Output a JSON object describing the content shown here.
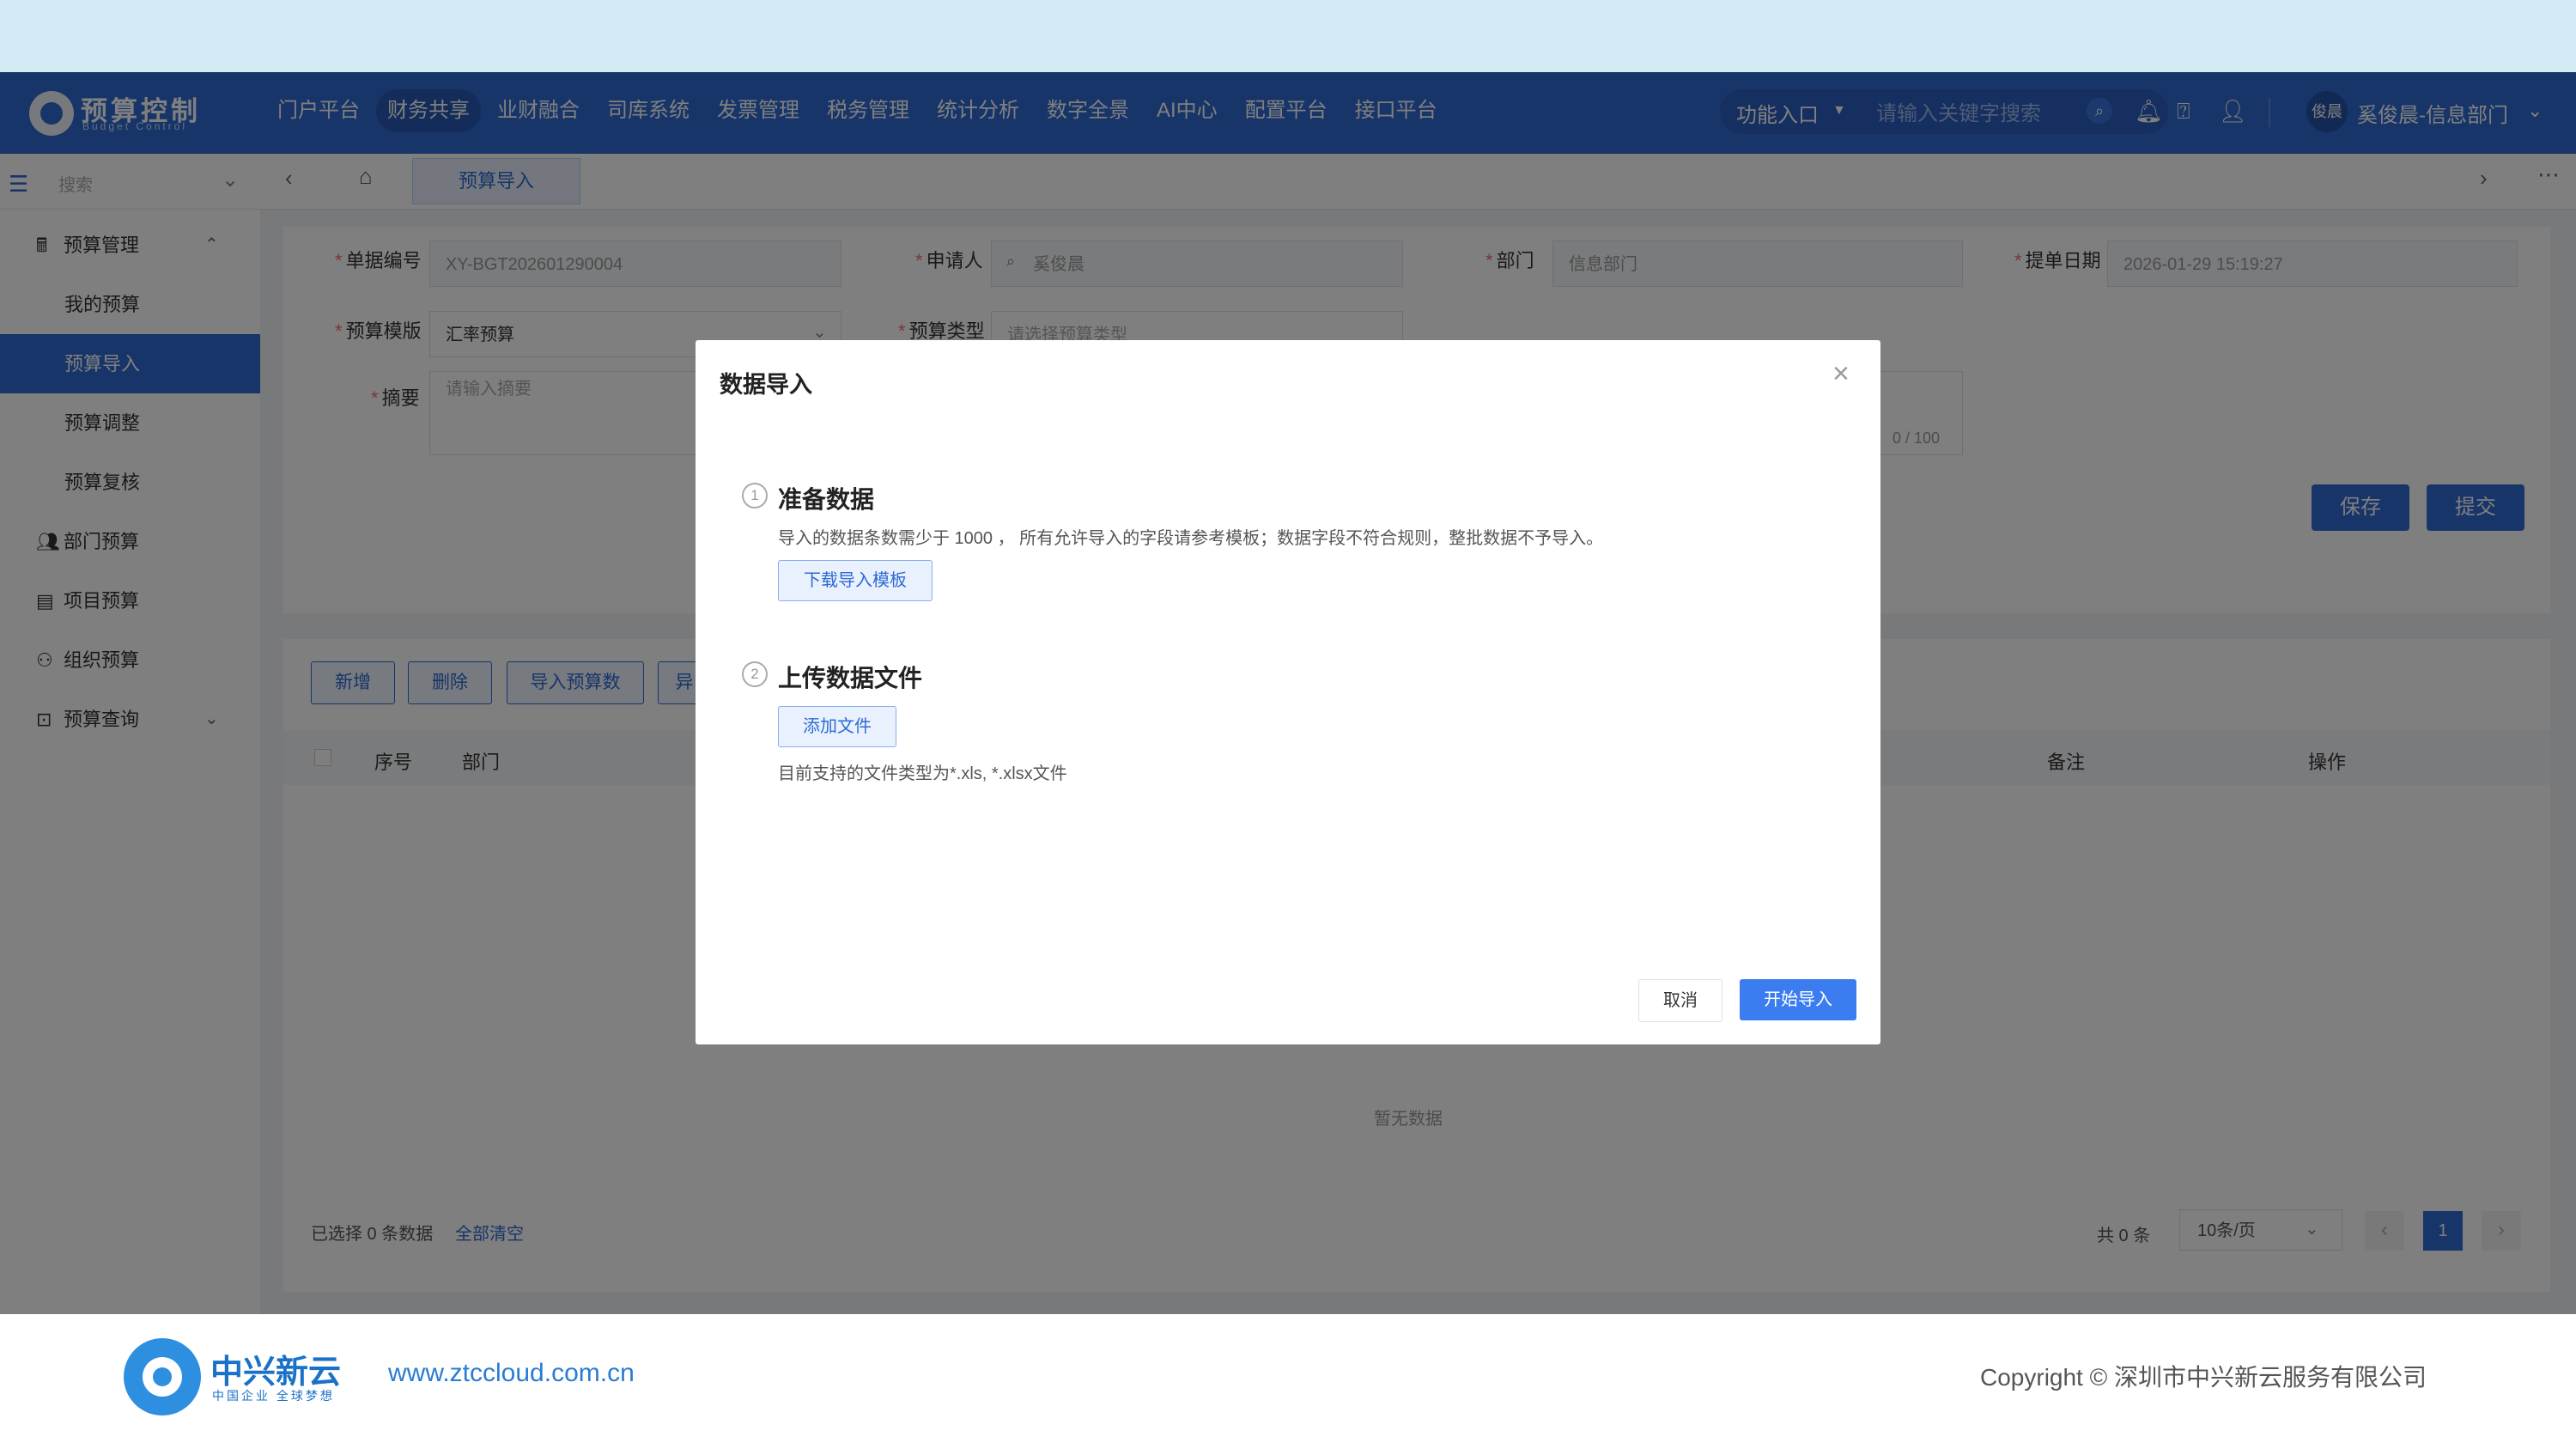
{
  "header": {
    "logo_title": "预算控制",
    "logo_subtitle": "Budget Control",
    "nav": [
      "门户平台",
      "财务共享",
      "业财融合",
      "司库系统",
      "发票管理",
      "税务管理",
      "统计分析",
      "数字全景",
      "AI中心",
      "配置平台",
      "接口平台"
    ],
    "nav_active_index": 1,
    "func_entry": "功能入口",
    "search_placeholder": "请输入关键字搜索",
    "avatar_text": "俊晨",
    "user": "奚俊晨-信息部门"
  },
  "sidebar": {
    "search_placeholder": "搜索",
    "groups": [
      {
        "label": "预算管理",
        "icon": "calculator-icon",
        "expanded": true
      },
      {
        "label": "我的预算"
      },
      {
        "label": "预算导入",
        "active": true
      },
      {
        "label": "预算调整"
      },
      {
        "label": "预算复核"
      },
      {
        "label": "部门预算",
        "icon": "people-icon"
      },
      {
        "label": "项目预算",
        "icon": "document-icon"
      },
      {
        "label": "组织预算",
        "icon": "org-tree-icon"
      },
      {
        "label": "预算查询",
        "icon": "search-doc-icon",
        "expanded": false
      }
    ]
  },
  "tabs": {
    "active_tab": "预算导入"
  },
  "form": {
    "doc_no_label": "单据编号",
    "doc_no": "XY-BGT202601290004",
    "applicant_label": "申请人",
    "applicant": "奚俊晨",
    "dept_label": "部门",
    "dept": "信息部门",
    "date_label": "提单日期",
    "date": "2026-01-29 15:19:27",
    "template_label": "预算模版",
    "template": "汇率预算",
    "type_label": "预算类型",
    "type_placeholder": "请选择预算类型",
    "summary_label": "摘要",
    "summary_placeholder": "请输入摘要",
    "summary_counter": "0 / 100",
    "save": "保存",
    "submit": "提交"
  },
  "table": {
    "buttons": [
      "新增",
      "删除",
      "导入预算数",
      "异"
    ],
    "columns": {
      "index": "序号",
      "dept": "部门",
      "remark": "备注",
      "action": "操作"
    },
    "empty_text": "暂无数据",
    "selected_text": "已选择 0 条数据",
    "clear_all": "全部清空",
    "total": "共 0 条",
    "page_size": "10条/页",
    "current_page": "1"
  },
  "modal": {
    "title": "数据导入",
    "step1_num": "1",
    "step1_title": "准备数据",
    "step1_desc": "导入的数据条数需少于 1000 ， 所有允许导入的字段请参考模板；数据字段不符合规则，整批数据不予导入。",
    "download_template": "下载导入模板",
    "step2_num": "2",
    "step2_title": "上传数据文件",
    "add_file": "添加文件",
    "file_types": "目前支持的文件类型为*.xls, *.xlsx文件",
    "cancel": "取消",
    "start_import": "开始导入"
  },
  "footer": {
    "brand": "中兴新云",
    "slogan": "中国企业 全球梦想",
    "url": "www.ztccloud.com.cn",
    "copyright": "Copyright © 深圳市中兴新云服务有限公司"
  },
  "colors": {
    "primary": "#2f6ad3",
    "start_button": "#3b7df1",
    "required": "#f56c6c"
  }
}
